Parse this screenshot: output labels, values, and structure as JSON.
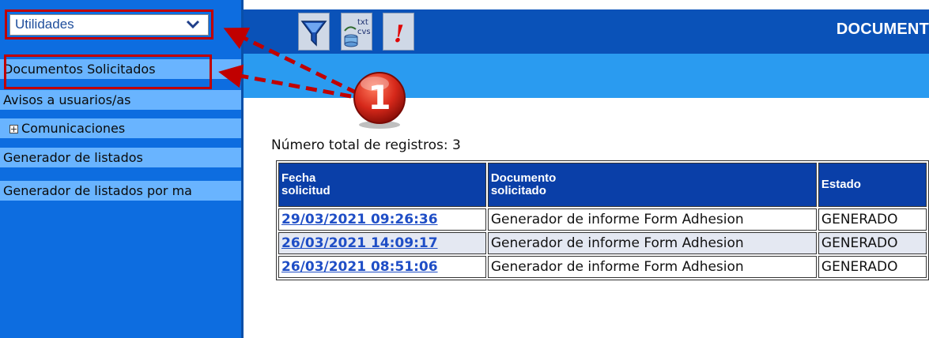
{
  "sidebar": {
    "dropdown": {
      "label": "Utilidades"
    },
    "items": [
      {
        "label": "Documentos Solicitados"
      },
      {
        "label": "Avisos a usuarios/as"
      },
      {
        "label": "Comunicaciones"
      },
      {
        "label": "Generador de listados"
      },
      {
        "label": "Generador de listados por ma"
      }
    ]
  },
  "toolbar": {
    "buttons": [
      {
        "icon": "filter-icon"
      },
      {
        "icon": "export-txt-cvs-icon",
        "label_top": "txt",
        "label_bottom": "cvs"
      },
      {
        "icon": "alert-icon",
        "label": "!"
      }
    ]
  },
  "header": {
    "title": "DOCUMENT"
  },
  "callout": {
    "number": "1"
  },
  "main": {
    "total_label": "Número total de registros: 3",
    "table": {
      "headers": [
        {
          "line1": "Fecha",
          "line2": "solicitud"
        },
        {
          "line1": "Documento",
          "line2": "solicitado"
        },
        {
          "line1": "Estado",
          "line2": ""
        }
      ],
      "rows": [
        {
          "date": "29/03/2021 09:26:36",
          "document": "Generador de informe Form Adhesion",
          "status": "GENERADO"
        },
        {
          "date": "26/03/2021 14:09:17",
          "document": "Generador de informe Form Adhesion",
          "status": "GENERADO"
        },
        {
          "date": "26/03/2021 08:51:06",
          "document": "Generador de informe Form Adhesion",
          "status": "GENERADO"
        }
      ]
    }
  },
  "colors": {
    "sidebar_bg": "#0d6de0",
    "menu_item_bg": "#69b4ff",
    "header_bg": "#0a52b8",
    "table_header_bg": "#0a3fa8",
    "highlight_red": "#c00000",
    "link": "#1f4ec6"
  }
}
